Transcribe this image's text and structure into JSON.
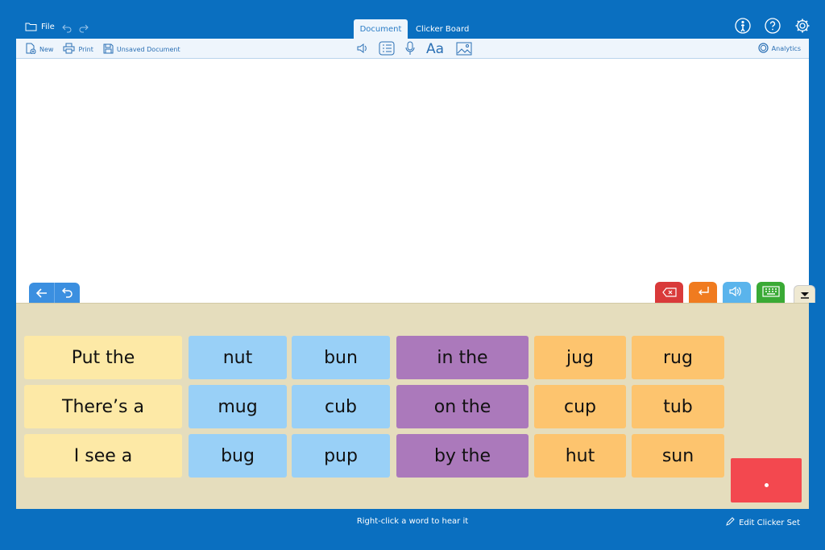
{
  "topbar": {
    "file_label": "File",
    "icons": [
      "folder-icon",
      "undo-icon",
      "redo-icon",
      "accessibility-icon",
      "help-icon",
      "settings-icon"
    ]
  },
  "tabs": [
    {
      "label": "Document",
      "active": true
    },
    {
      "label": "Clicker Board",
      "active": false
    }
  ],
  "toolbar": {
    "new_label": "New",
    "print_label": "Print",
    "doc_name": "Unsaved Document",
    "analytics_label": "Analytics",
    "center_icons": [
      "speaker-icon",
      "list-icon",
      "microphone-icon",
      "font-icon",
      "image-icon"
    ]
  },
  "document": {
    "content": ""
  },
  "grid": {
    "col1": [
      "Put the",
      "There’s a",
      "I see a"
    ],
    "col2": [
      "nut",
      "mug",
      "bug"
    ],
    "col3": [
      "bun",
      "cub",
      "pup"
    ],
    "col4": [
      "in the",
      "on the",
      "by the"
    ],
    "col5": [
      "jug",
      "cup",
      "hut"
    ],
    "col6": [
      "rug",
      "tub",
      "sun"
    ]
  },
  "colors": {
    "background": "#0a6fc0",
    "yellow": "#fde9a6",
    "blue": "#99d0f7",
    "purple": "#ab79bb",
    "orange": "#fdc46e",
    "red_pad": "#f3484f"
  },
  "status": {
    "hint": "Right-click a word to hear it",
    "edit_set_label": "Edit Clicker Set"
  }
}
